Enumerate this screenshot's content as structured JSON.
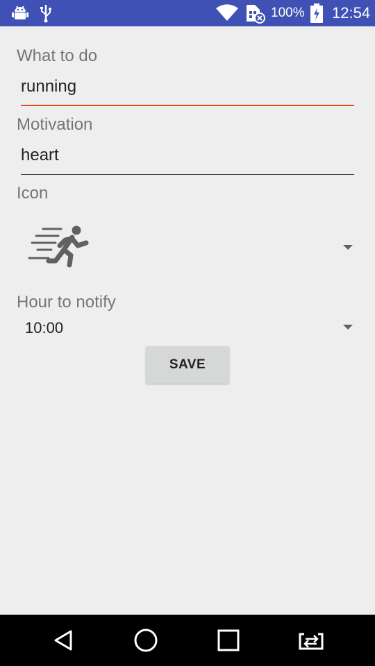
{
  "status_bar": {
    "battery_percent": "100%",
    "time": "12:54",
    "icons": [
      "android-debug-icon",
      "usb-icon",
      "wifi-icon",
      "sim-error-icon",
      "battery-charging-icon"
    ]
  },
  "form": {
    "what_label": "What to do",
    "what_value": "running",
    "motivation_label": "Motivation",
    "motivation_value": "heart",
    "icon_label": "Icon",
    "icon_selected": "running-person-icon",
    "hour_label": "Hour to notify",
    "hour_value": "10:00",
    "save_label": "SAVE"
  },
  "nav_bar": {
    "icons": [
      "back-icon",
      "home-icon",
      "recents-icon",
      "screen-switch-icon"
    ]
  },
  "colors": {
    "status_bar": "#3f51b5",
    "background": "#eeeeee",
    "focus_accent": "#e64a19",
    "button": "#d6d7d7",
    "nav_bar": "#000000"
  }
}
